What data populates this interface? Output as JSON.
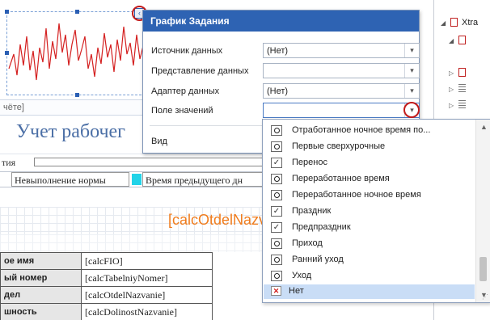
{
  "report": {
    "chart_caption": "чёте]",
    "title": "Учет рабочег",
    "row_label": "тия",
    "legend": {
      "item1": "Невыполнение нормы",
      "item2": "Время предыдущего дн",
      "swatch_color": "#22d3e8"
    },
    "dept_field": "[calcOtdelNazvanie]",
    "rows": [
      {
        "label": "ое имя",
        "value": "[calcFIO]"
      },
      {
        "label": "ый номер",
        "value": "[calcTabelniyNomer]"
      },
      {
        "label": "дел",
        "value": "[calcOtdelNazvanie]"
      },
      {
        "label": "шность",
        "value": "[calcDolinostNazvanie]"
      }
    ]
  },
  "tree": {
    "root_label": "Xtra"
  },
  "popup": {
    "title": "График Задания",
    "smart_tag_glyph": "‹",
    "properties": [
      {
        "label": "Источник данных",
        "value": "(Нет)"
      },
      {
        "label": "Представление данных",
        "value": ""
      },
      {
        "label": "Адаптер данных",
        "value": "(Нет)"
      },
      {
        "label": "Поле значений",
        "value": ""
      },
      {
        "label": "Вид",
        "value": ""
      }
    ]
  },
  "dropdown": {
    "items": [
      {
        "icon": "clock-icon",
        "label": "Отработанное ночное время по..."
      },
      {
        "icon": "clock-icon",
        "label": "Первые сверхурочные"
      },
      {
        "icon": "check-icon",
        "label": "Перенос"
      },
      {
        "icon": "clock-icon",
        "label": "Переработанное время"
      },
      {
        "icon": "clock-icon",
        "label": "Переработанное ночное время"
      },
      {
        "icon": "check-icon",
        "label": "Праздник"
      },
      {
        "icon": "check-icon",
        "label": "Предпраздник"
      },
      {
        "icon": "clock-icon",
        "label": "Приход"
      },
      {
        "icon": "clock-icon",
        "label": "Ранний уход"
      },
      {
        "icon": "clock-icon",
        "label": "Уход"
      }
    ],
    "selected": {
      "icon": "x-icon",
      "label": "Нет"
    }
  },
  "colors": {
    "header_blue": "#2e63b3",
    "selection": "#c9ddf6",
    "highlight_ring": "#c21a1a",
    "dept_text": "#f07c1c"
  }
}
